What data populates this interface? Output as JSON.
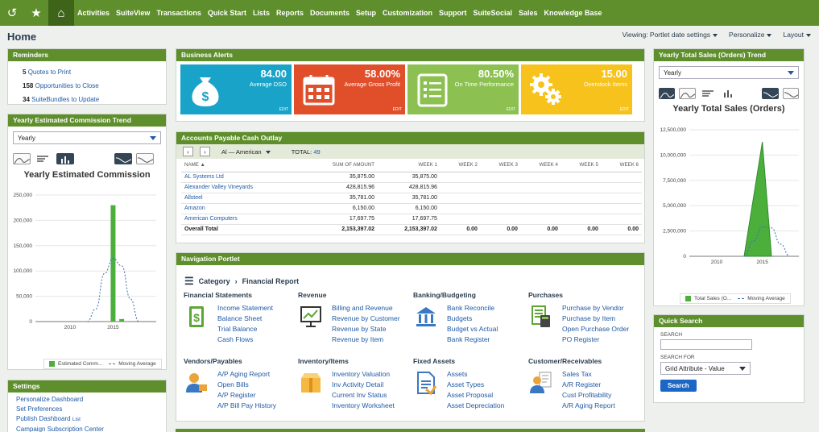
{
  "nav": {
    "items": [
      "Activities",
      "SuiteView",
      "Transactions",
      "Quick Start",
      "Lists",
      "Reports",
      "Documents",
      "Setup",
      "Customization",
      "Support",
      "SuiteSocial",
      "Sales",
      "Knowledge Base"
    ]
  },
  "page": {
    "title": "Home",
    "viewing": "Viewing: Portlet date settings",
    "personalize": "Personalize",
    "layout": "Layout"
  },
  "reminders": {
    "title": "Reminders",
    "items": [
      {
        "count": "5",
        "label": "Quotes to Print"
      },
      {
        "count": "158",
        "label": "Opportunities to Close"
      },
      {
        "count": "34",
        "label": "SuiteBundles to Update"
      }
    ]
  },
  "commission": {
    "title": "Yearly Estimated Commission Trend",
    "period": "Yearly",
    "chart_title": "Yearly Estimated Commission",
    "legend": [
      "Estimated Comm...",
      "Moving Average"
    ]
  },
  "settings": {
    "title": "Settings",
    "links": [
      "Personalize Dashboard",
      "Set Preferences",
      "Publish Dashboard",
      "Campaign Subscription Center"
    ],
    "list_tag": "List"
  },
  "alerts": {
    "title": "Business Alerts",
    "items": [
      {
        "value": "84.00",
        "label": "Average DSO",
        "edit": "EDIT",
        "color": "#1aa3c8"
      },
      {
        "value": "58.00%",
        "label": "Average Gross Profit",
        "edit": "EDIT",
        "color": "#e04e2a"
      },
      {
        "value": "80.50%",
        "label": "On Time Performance",
        "edit": "EDIT",
        "color": "#8cc152"
      },
      {
        "value": "15.00",
        "label": "Overstock Items",
        "edit": "EDIT",
        "color": "#f7c21b"
      }
    ]
  },
  "ap": {
    "title": "Accounts Payable Cash Outlay",
    "filter": "Al — American",
    "total_label": "TOTAL:",
    "total_value": "49",
    "columns": [
      "NAME ▲",
      "SUM OF AMOUNT",
      "WEEK 1",
      "WEEK 2",
      "WEEK 3",
      "WEEK 4",
      "WEEK 5",
      "WEEK 6"
    ],
    "rows": [
      [
        "AL Systems Ltd",
        "35,875.00",
        "35,875.00",
        "",
        "",
        "",
        "",
        ""
      ],
      [
        "Alexander Valley Vineyards",
        "428,815.96",
        "428,815.96",
        "",
        "",
        "",
        "",
        ""
      ],
      [
        "Allsteel",
        "35,781.00",
        "35,781.00",
        "",
        "",
        "",
        "",
        ""
      ],
      [
        "Amazon",
        "6,150.00",
        "6,150.00",
        "",
        "",
        "",
        "",
        ""
      ],
      [
        "American Computers",
        "17,697.75",
        "17,697.75",
        "",
        "",
        "",
        "",
        ""
      ]
    ],
    "total_row": [
      "Overall Total",
      "2,153,397.02",
      "2,153,397.02",
      "0.00",
      "0.00",
      "0.00",
      "0.00",
      "0.00"
    ]
  },
  "navportlet": {
    "title": "Navigation Portlet",
    "crumb_category": "Category",
    "crumb_current": "Financial Report",
    "sections": [
      {
        "name": "Financial Statements",
        "links": [
          "Income Statement",
          "Balance Sheet",
          "Trial Balance",
          "Cash Flows"
        ]
      },
      {
        "name": "Revenue",
        "links": [
          "Billing and Revenue",
          "Revenue by Customer",
          "Revenue by State",
          "Revenue by Item"
        ]
      },
      {
        "name": "Banking/Budgeting",
        "links": [
          "Bank Reconcile",
          "Budgets",
          "Budget vs Actual",
          "Bank Register"
        ]
      },
      {
        "name": "Purchases",
        "links": [
          "Purchase by Vendor",
          "Purchase by Item",
          "Open Purchase Order",
          "PO Register"
        ]
      },
      {
        "name": "Vendors/Payables",
        "links": [
          "A/P Aging Report",
          "Open Bills",
          "A/P Register",
          "A/P Bill Pay History"
        ]
      },
      {
        "name": "Inventory/Items",
        "links": [
          "Inventory Valuation",
          "Inv Activity Detail",
          "Current Inv Status",
          "Inventory Worksheet"
        ]
      },
      {
        "name": "Fixed Assets",
        "links": [
          "Assets",
          "Asset Types",
          "Asset Proposal",
          "Asset Depreciation"
        ]
      },
      {
        "name": "Customer/Receivables",
        "links": [
          "Sales Tax",
          "A/R Register",
          "Cust Profitability",
          "A/R Aging Report"
        ]
      }
    ]
  },
  "sales": {
    "title": "Yearly Total Sales (Orders) Trend",
    "period": "Yearly",
    "chart_title": "Yearly Total Sales (Orders)",
    "legend": [
      "Total Sales (O...",
      "Moving Average"
    ]
  },
  "quicksearch": {
    "title": "Quick Search",
    "search_label": "SEARCH",
    "search_for_label": "SEARCH FOR",
    "search_for_value": "Grid Attribute - Value",
    "button": "Search"
  },
  "chart_data": [
    {
      "type": "area",
      "title": "Yearly Estimated Commission",
      "yticks": [
        "250,000",
        "200,000",
        "150,000",
        "100,000",
        "50,000",
        "0"
      ],
      "ylim": [
        0,
        250000
      ],
      "x_ticks": [
        "2010",
        "2015"
      ],
      "series": [
        {
          "name": "Estimated Comm...",
          "type": "bar",
          "points": [
            [
              2015,
              230000
            ],
            [
              2016,
              5000
            ]
          ]
        },
        {
          "name": "Moving Average",
          "type": "dashed-line",
          "points": [
            [
              2012,
              0
            ],
            [
              2013,
              25000
            ],
            [
              2014,
              95000
            ],
            [
              2015,
              125000
            ],
            [
              2016,
              110000
            ],
            [
              2017,
              45000
            ],
            [
              2018,
              0
            ]
          ]
        }
      ]
    },
    {
      "type": "area",
      "title": "Yearly Total Sales (Orders)",
      "yticks": [
        "12,500,000",
        "10,000,000",
        "7,500,000",
        "5,000,000",
        "2,500,000",
        "0"
      ],
      "ylim": [
        0,
        12500000
      ],
      "x_ticks": [
        "2010",
        "2015"
      ],
      "series": [
        {
          "name": "Total Sales (O...",
          "type": "area",
          "points": [
            [
              2013,
              0
            ],
            [
              2015,
              11300000
            ],
            [
              2016,
              0
            ]
          ]
        },
        {
          "name": "Moving Average",
          "type": "dashed-line",
          "points": [
            [
              2013,
              0
            ],
            [
              2014,
              1500000
            ],
            [
              2015,
              2900000
            ],
            [
              2016,
              2800000
            ],
            [
              2017,
              1200000
            ],
            [
              2018,
              0
            ]
          ]
        }
      ]
    }
  ]
}
